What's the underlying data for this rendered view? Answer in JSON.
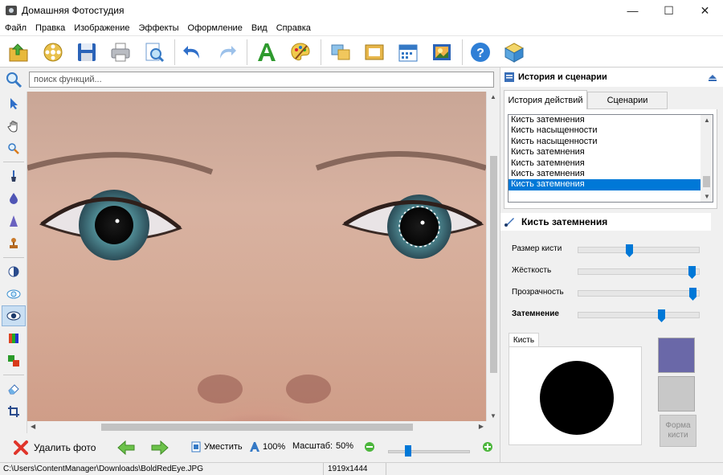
{
  "window": {
    "title": "Домашняя Фотостудия",
    "controls": [
      "—",
      "☐",
      "✕"
    ]
  },
  "menu": [
    "Файл",
    "Правка",
    "Изображение",
    "Эффекты",
    "Оформление",
    "Вид",
    "Справка"
  ],
  "toolbar": {
    "icons": [
      "open-folder-icon",
      "film-reel-icon",
      "save-disk-icon",
      "printer-icon",
      "preview-magnifier-icon",
      "undo-arrow-icon",
      "redo-arrow-icon",
      "text-a-icon",
      "palette-icon",
      "collage-icon",
      "frame-icon",
      "calendar-icon",
      "postcard-icon",
      "help-icon",
      "cube-home-icon"
    ]
  },
  "search": {
    "placeholder": "поиск функций..."
  },
  "left_tools": [
    "arrow-pointer-icon",
    "hand-pan-icon",
    "zoom-tool-icon",
    "brush-tool-icon",
    "drop-tool-icon",
    "cone-tool-icon",
    "stamp-tool-icon",
    "contrast-tool-icon",
    "lighten-eye-icon",
    "darken-eye-icon",
    "color-levels-icon",
    "replace-color-icon",
    "eraser-icon",
    "crop-icon"
  ],
  "right_panel": {
    "header_title": "История и сценарии",
    "tabs": [
      "История действий",
      "Сценарии"
    ],
    "history": [
      "Кисть затемнения",
      "Кисть насыщенности",
      "Кисть насыщенности",
      "Кисть затемнения",
      "Кисть затемнения",
      "Кисть затемнения",
      "Кисть затемнения"
    ],
    "selected_history_index": 6,
    "tool_title": "Кисть затемнения",
    "sliders": [
      {
        "label": "Размер кисти",
        "value": 0.42,
        "bold": false
      },
      {
        "label": "Жёсткость",
        "value": 0.97,
        "bold": false
      },
      {
        "label": "Прозрачность",
        "value": 0.98,
        "bold": false
      },
      {
        "label": "Затемнение",
        "value": 0.7,
        "bold": true
      }
    ],
    "brush_tab_label": "Кисть",
    "brush_color": "#6a68a8",
    "secondary_color": "#c8c8c8",
    "shape_button_label": "Форма кисти"
  },
  "bottom": {
    "delete_label": "Удалить фото",
    "fit_label": "Уместить",
    "actual_size_label": "100%",
    "scale_label": "Масштаб:",
    "scale_value": "50%",
    "zoom_slider": 0.22
  },
  "status": {
    "path": "C:\\Users\\ContentManager\\Downloads\\BoldRedEye.JPG",
    "resolution": "1919x1444"
  },
  "colors": {
    "accent": "#0078d7",
    "iris": "#4f8a93"
  }
}
